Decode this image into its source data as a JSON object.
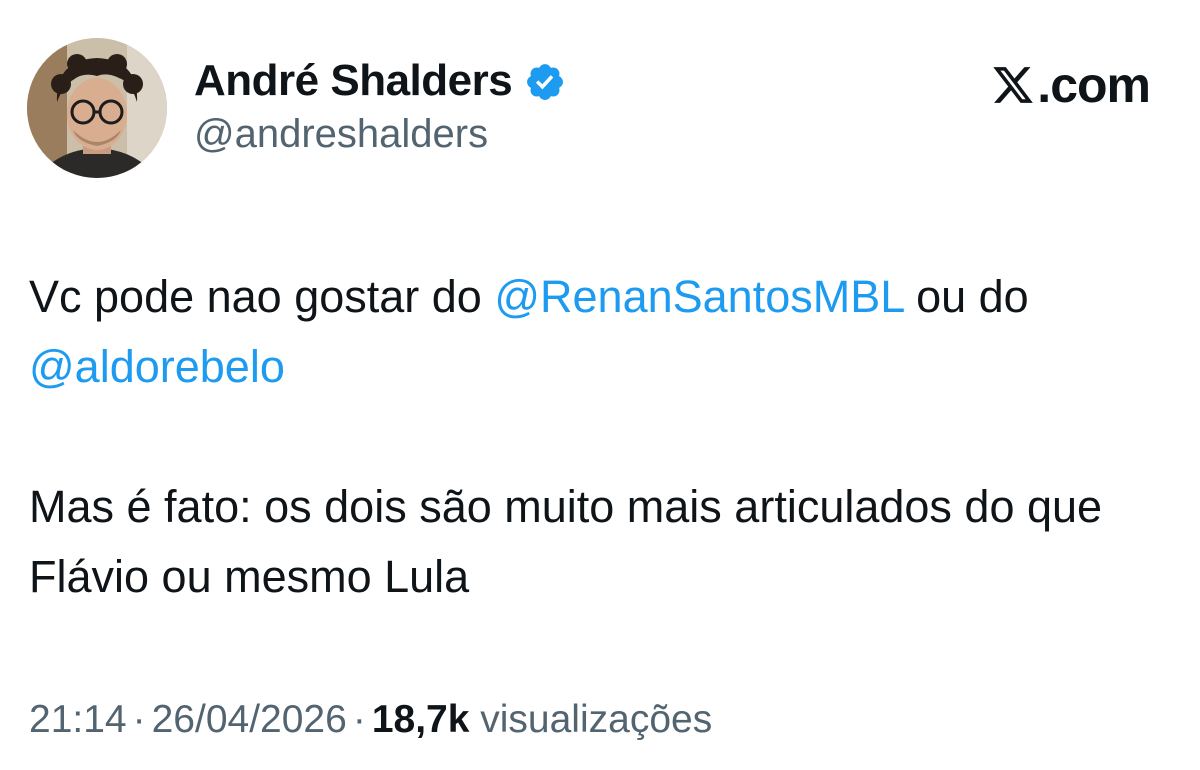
{
  "author": {
    "name": "André Shalders",
    "handle": "@andreshalders",
    "verified": true
  },
  "brand": {
    "text": ".com",
    "logo_icon": "x-logo-icon"
  },
  "tweet": {
    "paragraphs": [
      {
        "segments": [
          {
            "text": "Vc pode nao gostar do ",
            "type": "text"
          },
          {
            "text": "@RenanSantosMBL",
            "type": "mention"
          },
          {
            "text": " ou do ",
            "type": "text"
          },
          {
            "text": "@aldorebelo",
            "type": "mention"
          }
        ]
      },
      {
        "segments": [
          {
            "text": "Mas é fato: os dois são muito mais articulados do que Flávio ou mesmo Lula",
            "type": "text"
          }
        ]
      }
    ]
  },
  "meta": {
    "time": "21:14",
    "separator": "·",
    "date": "26/04/2026",
    "views_count": "18,7k",
    "views_label": "visualizações"
  },
  "colors": {
    "mention": "#1d9bf0",
    "verified": "#1d9bf0",
    "secondary_text": "#536471",
    "primary_text": "#0f1419"
  }
}
